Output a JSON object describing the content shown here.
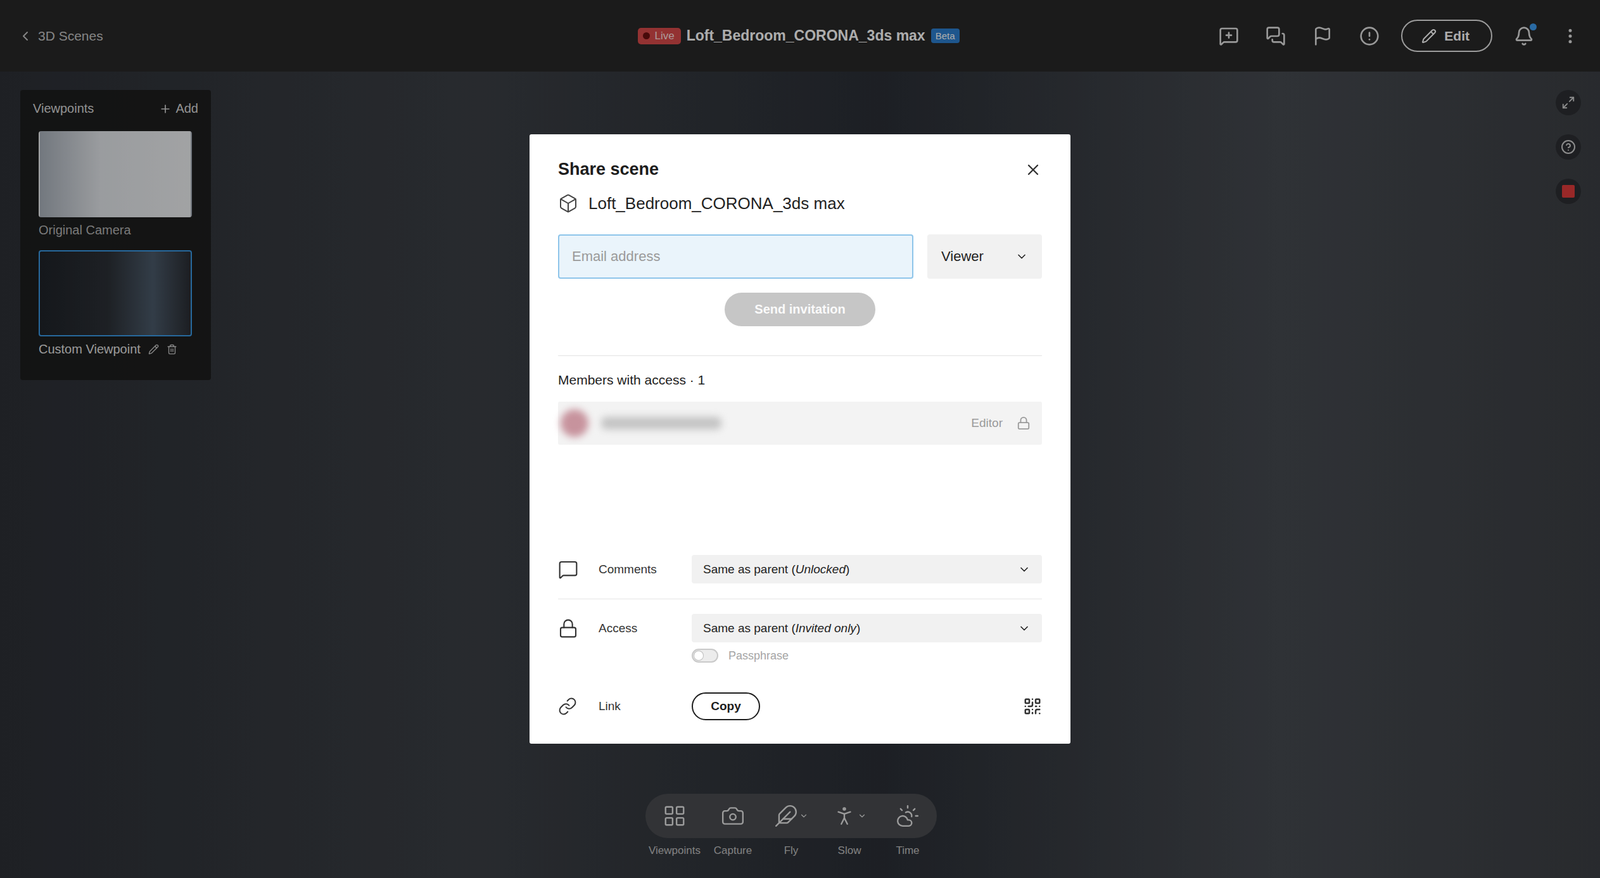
{
  "topbar": {
    "back": "3D Scenes",
    "live": "Live",
    "title": "Loft_Bedroom_CORONA_3ds max",
    "badge": "Beta",
    "edit": "Edit",
    "unread": true
  },
  "viewpoints": {
    "title": "Viewpoints",
    "add": "Add",
    "items": [
      {
        "label": "Original Camera",
        "selected": false
      },
      {
        "label": "Custom Viewpoint",
        "selected": true
      }
    ]
  },
  "toolbar": [
    {
      "label": "Viewpoints",
      "kind": "grid",
      "menu": false
    },
    {
      "label": "Capture",
      "kind": "camera",
      "menu": false
    },
    {
      "label": "Fly",
      "kind": "fly",
      "menu": true
    },
    {
      "label": "Slow",
      "kind": "walk",
      "menu": true
    },
    {
      "label": "Time",
      "kind": "time",
      "menu": false
    }
  ],
  "dialog": {
    "title": "Share scene",
    "scene": "Loft_Bedroom_CORONA_3ds max",
    "email_placeholder": "Email address",
    "role": "Viewer",
    "send": "Send invitation",
    "send_disabled": true,
    "members_title": "Members with access · 1",
    "members": [
      {
        "blurred": true,
        "role": "Editor",
        "locked": true
      }
    ],
    "settings": [
      {
        "kind": "comments",
        "label": "Comments",
        "value": "Same as parent (",
        "emphasis": "Unlocked",
        "tail": ")"
      },
      {
        "kind": "access",
        "label": "Access",
        "value": "Same as parent (",
        "emphasis": "Invited only",
        "tail": ")"
      }
    ],
    "passphrase": {
      "label": "Passphrase",
      "on": false
    },
    "link": {
      "label": "Link",
      "copy": "Copy"
    }
  }
}
